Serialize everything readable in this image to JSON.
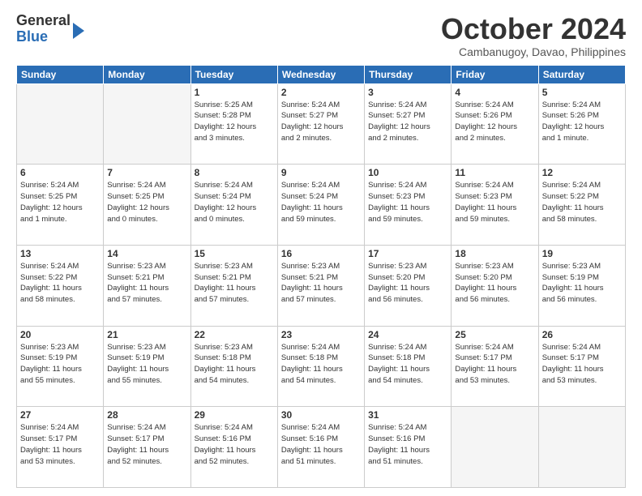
{
  "logo": {
    "general": "General",
    "blue": "Blue"
  },
  "header": {
    "month": "October 2024",
    "location": "Cambanugoy, Davao, Philippines"
  },
  "weekdays": [
    "Sunday",
    "Monday",
    "Tuesday",
    "Wednesday",
    "Thursday",
    "Friday",
    "Saturday"
  ],
  "weeks": [
    [
      {
        "day": "",
        "info": ""
      },
      {
        "day": "",
        "info": ""
      },
      {
        "day": "1",
        "info": "Sunrise: 5:25 AM\nSunset: 5:28 PM\nDaylight: 12 hours\nand 3 minutes."
      },
      {
        "day": "2",
        "info": "Sunrise: 5:24 AM\nSunset: 5:27 PM\nDaylight: 12 hours\nand 2 minutes."
      },
      {
        "day": "3",
        "info": "Sunrise: 5:24 AM\nSunset: 5:27 PM\nDaylight: 12 hours\nand 2 minutes."
      },
      {
        "day": "4",
        "info": "Sunrise: 5:24 AM\nSunset: 5:26 PM\nDaylight: 12 hours\nand 2 minutes."
      },
      {
        "day": "5",
        "info": "Sunrise: 5:24 AM\nSunset: 5:26 PM\nDaylight: 12 hours\nand 1 minute."
      }
    ],
    [
      {
        "day": "6",
        "info": "Sunrise: 5:24 AM\nSunset: 5:25 PM\nDaylight: 12 hours\nand 1 minute."
      },
      {
        "day": "7",
        "info": "Sunrise: 5:24 AM\nSunset: 5:25 PM\nDaylight: 12 hours\nand 0 minutes."
      },
      {
        "day": "8",
        "info": "Sunrise: 5:24 AM\nSunset: 5:24 PM\nDaylight: 12 hours\nand 0 minutes."
      },
      {
        "day": "9",
        "info": "Sunrise: 5:24 AM\nSunset: 5:24 PM\nDaylight: 11 hours\nand 59 minutes."
      },
      {
        "day": "10",
        "info": "Sunrise: 5:24 AM\nSunset: 5:23 PM\nDaylight: 11 hours\nand 59 minutes."
      },
      {
        "day": "11",
        "info": "Sunrise: 5:24 AM\nSunset: 5:23 PM\nDaylight: 11 hours\nand 59 minutes."
      },
      {
        "day": "12",
        "info": "Sunrise: 5:24 AM\nSunset: 5:22 PM\nDaylight: 11 hours\nand 58 minutes."
      }
    ],
    [
      {
        "day": "13",
        "info": "Sunrise: 5:24 AM\nSunset: 5:22 PM\nDaylight: 11 hours\nand 58 minutes."
      },
      {
        "day": "14",
        "info": "Sunrise: 5:23 AM\nSunset: 5:21 PM\nDaylight: 11 hours\nand 57 minutes."
      },
      {
        "day": "15",
        "info": "Sunrise: 5:23 AM\nSunset: 5:21 PM\nDaylight: 11 hours\nand 57 minutes."
      },
      {
        "day": "16",
        "info": "Sunrise: 5:23 AM\nSunset: 5:21 PM\nDaylight: 11 hours\nand 57 minutes."
      },
      {
        "day": "17",
        "info": "Sunrise: 5:23 AM\nSunset: 5:20 PM\nDaylight: 11 hours\nand 56 minutes."
      },
      {
        "day": "18",
        "info": "Sunrise: 5:23 AM\nSunset: 5:20 PM\nDaylight: 11 hours\nand 56 minutes."
      },
      {
        "day": "19",
        "info": "Sunrise: 5:23 AM\nSunset: 5:19 PM\nDaylight: 11 hours\nand 56 minutes."
      }
    ],
    [
      {
        "day": "20",
        "info": "Sunrise: 5:23 AM\nSunset: 5:19 PM\nDaylight: 11 hours\nand 55 minutes."
      },
      {
        "day": "21",
        "info": "Sunrise: 5:23 AM\nSunset: 5:19 PM\nDaylight: 11 hours\nand 55 minutes."
      },
      {
        "day": "22",
        "info": "Sunrise: 5:23 AM\nSunset: 5:18 PM\nDaylight: 11 hours\nand 54 minutes."
      },
      {
        "day": "23",
        "info": "Sunrise: 5:24 AM\nSunset: 5:18 PM\nDaylight: 11 hours\nand 54 minutes."
      },
      {
        "day": "24",
        "info": "Sunrise: 5:24 AM\nSunset: 5:18 PM\nDaylight: 11 hours\nand 54 minutes."
      },
      {
        "day": "25",
        "info": "Sunrise: 5:24 AM\nSunset: 5:17 PM\nDaylight: 11 hours\nand 53 minutes."
      },
      {
        "day": "26",
        "info": "Sunrise: 5:24 AM\nSunset: 5:17 PM\nDaylight: 11 hours\nand 53 minutes."
      }
    ],
    [
      {
        "day": "27",
        "info": "Sunrise: 5:24 AM\nSunset: 5:17 PM\nDaylight: 11 hours\nand 53 minutes."
      },
      {
        "day": "28",
        "info": "Sunrise: 5:24 AM\nSunset: 5:17 PM\nDaylight: 11 hours\nand 52 minutes."
      },
      {
        "day": "29",
        "info": "Sunrise: 5:24 AM\nSunset: 5:16 PM\nDaylight: 11 hours\nand 52 minutes."
      },
      {
        "day": "30",
        "info": "Sunrise: 5:24 AM\nSunset: 5:16 PM\nDaylight: 11 hours\nand 51 minutes."
      },
      {
        "day": "31",
        "info": "Sunrise: 5:24 AM\nSunset: 5:16 PM\nDaylight: 11 hours\nand 51 minutes."
      },
      {
        "day": "",
        "info": ""
      },
      {
        "day": "",
        "info": ""
      }
    ]
  ]
}
